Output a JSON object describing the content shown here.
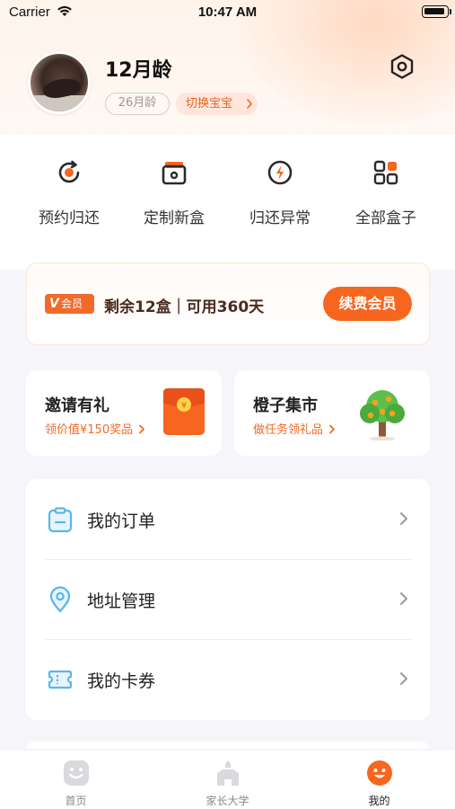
{
  "status_bar": {
    "carrier": "Carrier",
    "time": "10:47 AM"
  },
  "profile": {
    "name": "12月龄",
    "age_tag": "26月龄",
    "switch_baby": "切换宝宝"
  },
  "quick_actions": [
    {
      "label": "预约归还",
      "icon": "refresh-icon"
    },
    {
      "label": "定制新盒",
      "icon": "box-icon"
    },
    {
      "label": "归还异常",
      "icon": "lightning-icon"
    },
    {
      "label": "全部盒子",
      "icon": "grid-icon"
    }
  ],
  "vip": {
    "badge_letter": "V",
    "badge_text": "会员",
    "summary": "剩余12盒｜可用360天",
    "renew_button": "续费会员"
  },
  "promos": [
    {
      "title": "邀请有礼",
      "subtitle": "领价值¥150奖品",
      "icon": "red-envelope-icon"
    },
    {
      "title": "橙子集市",
      "subtitle": "做任务领礼品",
      "icon": "orange-tree-icon"
    }
  ],
  "menu": [
    {
      "label": "我的订单",
      "icon": "clipboard-icon"
    },
    {
      "label": "地址管理",
      "icon": "location-pin-icon"
    },
    {
      "label": "我的卡券",
      "icon": "ticket-icon"
    }
  ],
  "tabbar": [
    {
      "label": "首页",
      "icon": "smile-face-icon",
      "active": false
    },
    {
      "label": "家长大学",
      "icon": "university-icon",
      "active": false
    },
    {
      "label": "我的",
      "icon": "profile-face-icon",
      "active": true
    }
  ],
  "colors": {
    "accent": "#f7661f",
    "vip_text": "#4a2a1e",
    "muted": "#999999",
    "icon_blue": "#5bb6e8"
  }
}
